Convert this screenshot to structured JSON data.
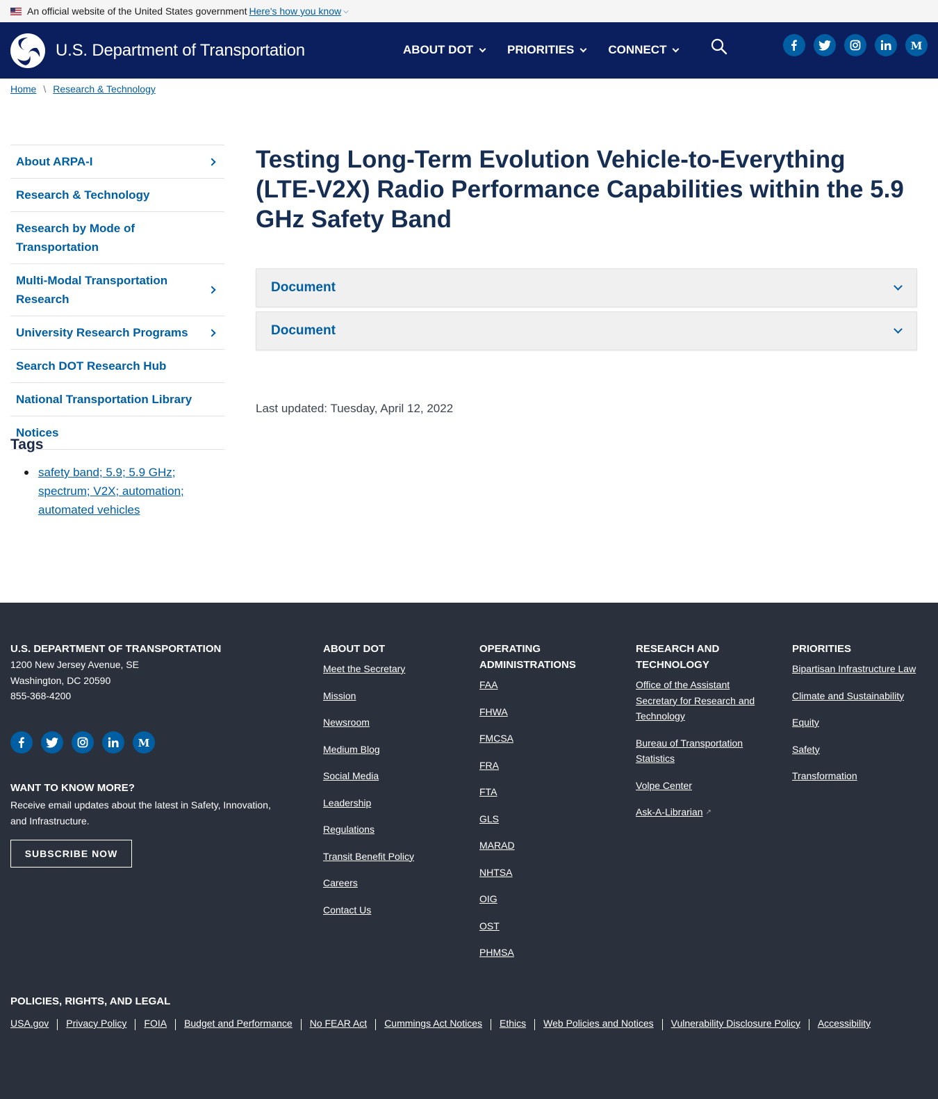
{
  "gov_banner": {
    "text": "An official website of the United States government",
    "link": "Here's how you know"
  },
  "header": {
    "site_name": "U.S. Department of Transportation",
    "nav": [
      {
        "label": "ABOUT DOT"
      },
      {
        "label": "PRIORITIES"
      },
      {
        "label": "CONNECT"
      }
    ],
    "social_icons": [
      "facebook-icon",
      "twitter-icon",
      "instagram-icon",
      "linkedin-icon",
      "medium-icon"
    ]
  },
  "breadcrumb": {
    "items": [
      "Home",
      "Research & Technology"
    ],
    "separator": "\\"
  },
  "sidebar": {
    "items": [
      {
        "label": "About ARPA-I",
        "has_children": true
      },
      {
        "label": "Research & Technology",
        "has_children": false
      },
      {
        "label": "Research by Mode of Transportation",
        "has_children": false
      },
      {
        "label": "Multi-Modal Transportation Research",
        "has_children": true
      },
      {
        "label": "University Research Programs",
        "has_children": true
      },
      {
        "label": "Search DOT Research Hub",
        "has_children": false
      },
      {
        "label": "National Transportation Library",
        "has_children": false
      },
      {
        "label": "Notices",
        "has_children": false
      }
    ],
    "tags_title": "Tags",
    "tags": [
      "safety band; 5.9; 5.9 GHz; spectrum; V2X; automation; automated vehicles"
    ]
  },
  "main": {
    "title": "Testing Long-Term Evolution Vehicle-to-Everything (LTE-V2X) Radio Performance Capabilities within the 5.9 GHz Safety Band",
    "accordions": [
      {
        "label": "Document"
      },
      {
        "label": "Document"
      }
    ],
    "last_updated": "Last updated: Tuesday, April 12, 2022"
  },
  "footer": {
    "org": {
      "name": "U.S. DEPARTMENT OF TRANSPORTATION",
      "address1": "1200 New Jersey Avenue, SE",
      "address2": "Washington, DC 20590",
      "phone": "855-368-4200"
    },
    "subscribe": {
      "heading": "WANT TO KNOW MORE?",
      "text": "Receive email updates about the latest in Safety, Innovation, and Infrastructure.",
      "button": "SUBSCRIBE NOW"
    },
    "columns": [
      {
        "heading": "ABOUT DOT",
        "links": [
          "Meet the Secretary",
          "Mission",
          "Newsroom",
          "Medium Blog",
          "Social Media",
          "Leadership",
          "Regulations",
          "Transit Benefit Policy",
          "Careers",
          "Contact Us"
        ]
      },
      {
        "heading": "OPERATING ADMINISTRATIONS",
        "links": [
          "FAA",
          "FHWA",
          "FMCSA",
          "FRA",
          "FTA",
          "GLS",
          "MARAD",
          "NHTSA",
          "OIG",
          "OST",
          "PHMSA"
        ]
      },
      {
        "heading": "RESEARCH AND TECHNOLOGY",
        "links": [
          "Office of the Assistant Secretary for Research and Technology",
          "Bureau of Transportation Statistics",
          "Volpe Center",
          "Ask-A-Librarian"
        ]
      },
      {
        "heading": "PRIORITIES",
        "links": [
          "Bipartisan Infrastructure Law",
          "Climate and Sustainability",
          "Equity",
          "Safety",
          "Transformation"
        ]
      }
    ],
    "policies_heading": "POLICIES, RIGHTS, AND LEGAL",
    "policies": [
      "USA.gov",
      "Privacy Policy",
      "FOIA",
      "Budget and Performance",
      "No FEAR Act",
      "Cummings Act Notices",
      "Ethics",
      "Web Policies and Notices",
      "Vulnerability Disclosure Policy",
      "Accessibility"
    ]
  },
  "colors": {
    "header_bg": "#0b1f5e",
    "link": "#005ea2",
    "title": "#162e51",
    "footer_bg": "#2a303c"
  }
}
